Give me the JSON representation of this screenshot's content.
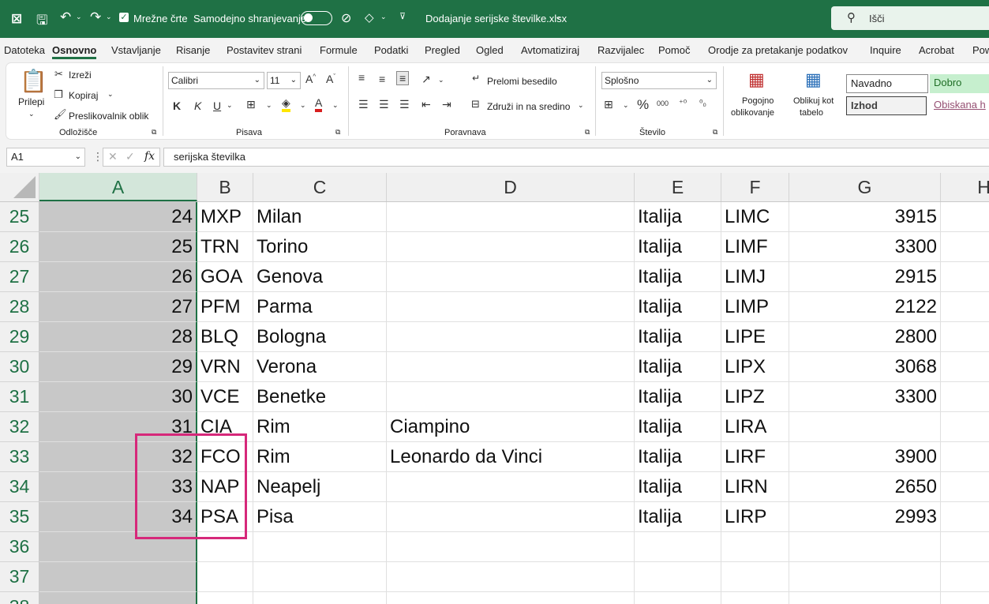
{
  "titlebar": {
    "autosave_cb_label": "Mrežne črte",
    "autosave_label": "Samodejno shranjevanje",
    "filename": "Dodajanje serijske številke.xlsx",
    "search_placeholder": "Išči"
  },
  "menu": [
    "Datoteka",
    "Osnovno",
    "Vstavljanje",
    "Risanje",
    "Postavitev strani",
    "Formule",
    "Podatki",
    "Pregled",
    "Ogled",
    "Avtomatiziraj",
    "Razvijalec",
    "Pomoč",
    "Orodje za pretakanje podatkov",
    "Inquire",
    "Acrobat",
    "Pow"
  ],
  "ribbon": {
    "clipboard": {
      "paste": "Prilepi",
      "cut": "Izreži",
      "copy": "Kopiraj",
      "painter": "Preslikovalnik oblik",
      "group": "Odložišče"
    },
    "font": {
      "name": "Calibri",
      "size": "11",
      "bold": "K",
      "italic": "K",
      "underline": "U",
      "group": "Pisava"
    },
    "alignment": {
      "wrap": "Prelomi besedilo",
      "merge": "Združi in na sredino",
      "group": "Poravnava"
    },
    "number": {
      "format": "Splošno",
      "group": "Število"
    },
    "styles": {
      "cond_fmt_1": "Pogojno",
      "cond_fmt_2": "oblikovanje",
      "as_table_1": "Oblikuj kot",
      "as_table_2": "tabelo",
      "normal": "Navadno",
      "good": "Dobro",
      "output": "Izhod",
      "visited": "Obiskana h"
    }
  },
  "formula_bar": {
    "cell_ref": "A1",
    "fx": "fx",
    "content": "serijska številka"
  },
  "columns": [
    "A",
    "B",
    "C",
    "D",
    "E",
    "F",
    "G",
    "H"
  ],
  "rows": [
    {
      "n": "25",
      "a": "24",
      "b": "MXP",
      "c": "Milan",
      "d": "",
      "e": "Italija",
      "f": "LIMC",
      "g": "3915"
    },
    {
      "n": "26",
      "a": "25",
      "b": "TRN",
      "c": "Torino",
      "d": "",
      "e": "Italija",
      "f": "LIMF",
      "g": "3300"
    },
    {
      "n": "27",
      "a": "26",
      "b": "GOA",
      "c": "Genova",
      "d": "",
      "e": "Italija",
      "f": "LIMJ",
      "g": "2915"
    },
    {
      "n": "28",
      "a": "27",
      "b": "PFM",
      "c": "Parma",
      "d": "",
      "e": "Italija",
      "f": "LIMP",
      "g": "2122"
    },
    {
      "n": "29",
      "a": "28",
      "b": "BLQ",
      "c": "Bologna",
      "d": "",
      "e": "Italija",
      "f": "LIPE",
      "g": "2800"
    },
    {
      "n": "30",
      "a": "29",
      "b": "VRN",
      "c": "Verona",
      "d": "",
      "e": "Italija",
      "f": "LIPX",
      "g": "3068"
    },
    {
      "n": "31",
      "a": "30",
      "b": "VCE",
      "c": "Benetke",
      "d": "",
      "e": "Italija",
      "f": "LIPZ",
      "g": "3300"
    },
    {
      "n": "32",
      "a": "31",
      "b": "CIA",
      "c": "Rim",
      "d": "Ciampino",
      "e": "Italija",
      "f": "LIRA",
      "g": ""
    },
    {
      "n": "33",
      "a": "32",
      "b": "FCO",
      "c": "Rim",
      "d": "Leonardo da Vinci",
      "e": "Italija",
      "f": "LIRF",
      "g": "3900"
    },
    {
      "n": "34",
      "a": "33",
      "b": "NAP",
      "c": "Neapelj",
      "d": "",
      "e": "Italija",
      "f": "LIRN",
      "g": "2650"
    },
    {
      "n": "35",
      "a": "34",
      "b": "PSA",
      "c": "Pisa",
      "d": "",
      "e": "Italija",
      "f": "LIRP",
      "g": "2993"
    },
    {
      "n": "36",
      "a": "",
      "b": "",
      "c": "",
      "d": "",
      "e": "",
      "f": "",
      "g": ""
    },
    {
      "n": "37",
      "a": "",
      "b": "",
      "c": "",
      "d": "",
      "e": "",
      "f": "",
      "g": ""
    },
    {
      "n": "38",
      "a": "",
      "b": "",
      "c": "",
      "d": "",
      "e": "",
      "f": "",
      "g": ""
    }
  ],
  "colors": {
    "accent": "#1f7145",
    "highlight": "#d6287a",
    "selected_col": "#c8c8c8"
  }
}
